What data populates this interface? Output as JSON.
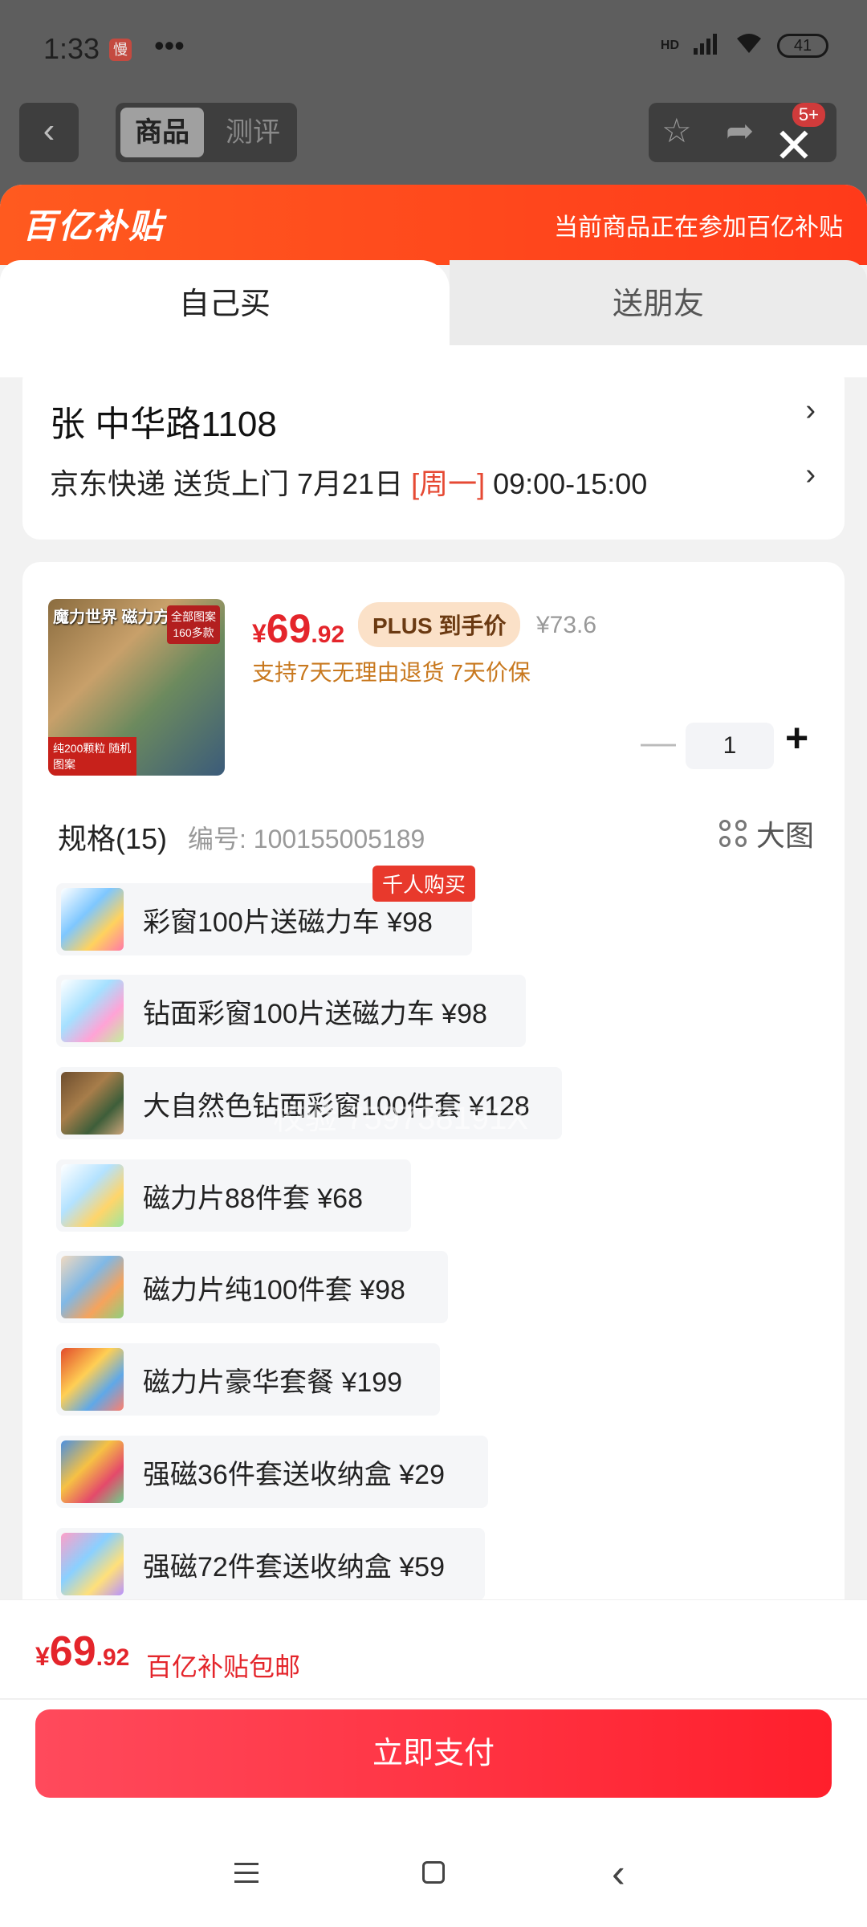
{
  "status_bar": {
    "time": "1:33",
    "app_badge": "慢",
    "more": "•••",
    "network": "HD",
    "battery": "41"
  },
  "background_nav": {
    "back_icon": "chevron-left-icon",
    "tabs": [
      "商品",
      "测评"
    ],
    "badge": "5+"
  },
  "subsidy": {
    "logo": "百亿补贴",
    "notice": "当前商品正在参加百亿补贴"
  },
  "buy_tabs": [
    "自己买",
    "送朋友"
  ],
  "address": {
    "name_line": "张   中华路1108",
    "delivery_prefix": "京东快递 送货上门 7月21日 ",
    "weekday": "[周一]",
    "time_slot": " 09:00-15:00"
  },
  "product": {
    "image_title": "魔力世界 磁力方块",
    "image_tag": "全部图案 160多款",
    "image_bottom": "纯200颗粒 随机图案",
    "price_symbol": "¥",
    "price_int": "69",
    "price_dec": ".92",
    "plus_tag": "PLUS 到手价",
    "original_price": "¥73.6",
    "service": "支持7天无理由退货  7天价保",
    "quantity": "1"
  },
  "spec": {
    "heading": "规格(15)",
    "code": "编号: 100155005189",
    "big_view": "大图",
    "hot_tag": "千人购买",
    "items": [
      {
        "label": "彩窗100片送磁力车  ¥98"
      },
      {
        "label": "钻面彩窗100片送磁力车  ¥98"
      },
      {
        "label": "大自然色钻面彩窗100件套  ¥128"
      },
      {
        "label": "磁力片88件套  ¥68"
      },
      {
        "label": "磁力片纯100件套  ¥98"
      },
      {
        "label": "磁力片豪华套餐  ¥199"
      },
      {
        "label": "强磁36件套送收纳盒  ¥29"
      },
      {
        "label": "强磁72件套送收纳盒  ¥59"
      }
    ]
  },
  "watermark": "校验 759738191X",
  "bottom": {
    "price_symbol": "¥",
    "price_int": "69",
    "price_dec": ".92",
    "note": "百亿补贴包邮",
    "pay_button": "立即支付"
  },
  "colors": {
    "accent_red": "#e4252b",
    "subsidy_orange": "#ff4a1f",
    "service_orange": "#c8781e"
  }
}
